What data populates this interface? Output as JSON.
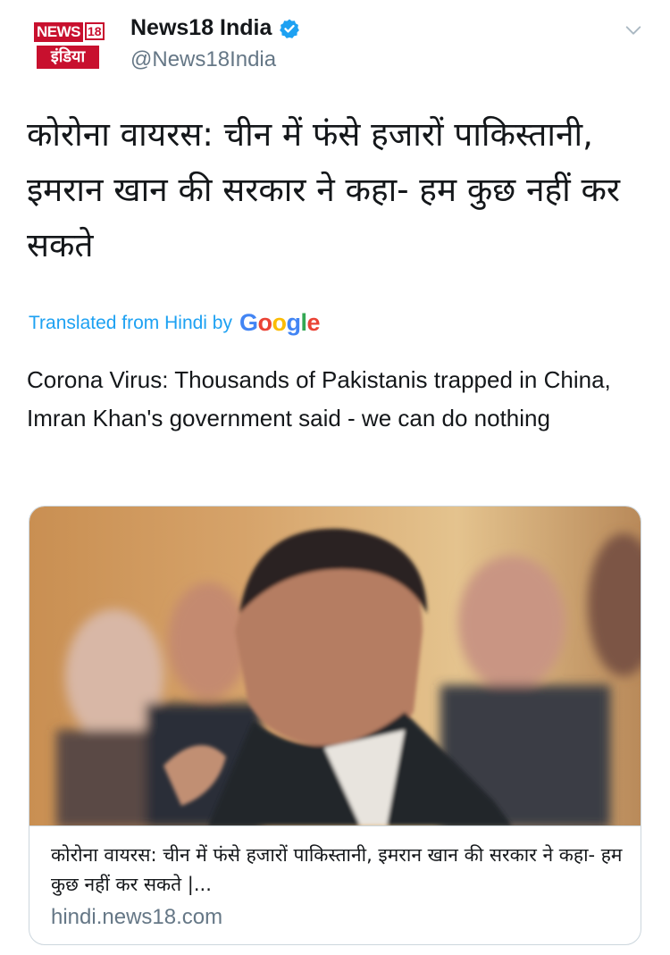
{
  "account": {
    "logo_top": "NEWS",
    "logo_num": "18",
    "logo_bottom": "इंडिया",
    "display_name": "News18 India",
    "handle": "@News18India",
    "verified": true
  },
  "tweet": {
    "text_hindi": "कोरोना वायरस: चीन में फंसे हजारों पाकिस्तानी, इमरान खान की सरकार ने कहा- हम कुछ नहीं कर सकते",
    "translated_label": "Translated from Hindi by",
    "translator_brand": [
      "G",
      "o",
      "o",
      "g",
      "l",
      "e"
    ],
    "text_english": "Corona Virus: Thousands of Pakistanis trapped in China, Imran Khan's government said - we can do nothing"
  },
  "card": {
    "title": "कोरोना वायरस: चीन में फंसे हजारों पाकिस्तानी, इमरान खान की सरकार ने कहा- हम कुछ नहीं कर सकते |...",
    "domain": "hindi.news18.com"
  },
  "icons": {
    "verified": "verified-badge-icon",
    "menu": "chevron-down-icon"
  },
  "colors": {
    "link_blue": "#1da1f2",
    "secondary_text": "#657786",
    "brand_red": "#c8102e"
  }
}
